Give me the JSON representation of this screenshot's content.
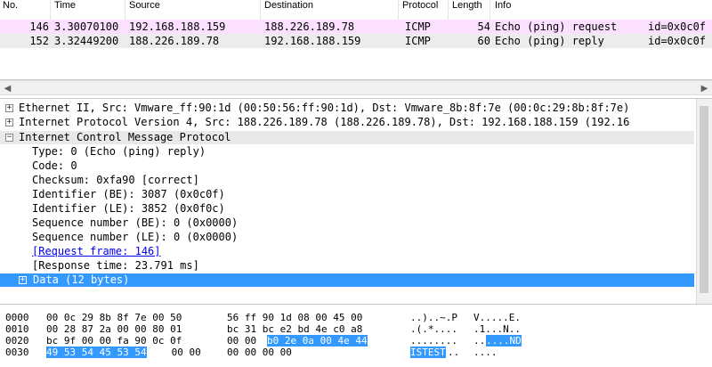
{
  "packet_list": {
    "columns": [
      "No.",
      "Time",
      "Source",
      "Destination",
      "Protocol",
      "Length",
      "Info"
    ],
    "rows": [
      {
        "no": "146",
        "time": "3.30070100",
        "source": "192.168.188.159",
        "destination": "188.226.189.78",
        "protocol": "ICMP",
        "length": "54",
        "info": "Echo (ping) request",
        "info_id": "id=0x0c0f"
      },
      {
        "no": "152",
        "time": "3.32449200",
        "source": "188.226.189.78",
        "destination": "192.168.188.159",
        "protocol": "ICMP",
        "length": "60",
        "info": "Echo (ping) reply",
        "info_id": "id=0x0c0f"
      }
    ],
    "colors": {
      "request_row": "#fce0ff",
      "reply_row": "#ececec"
    }
  },
  "scrollbar": {
    "left_arrow": "◀",
    "right_arrow": "▶"
  },
  "details": {
    "ethernet": "Ethernet II, Src: Vmware_ff:90:1d (00:50:56:ff:90:1d), Dst: Vmware_8b:8f:7e (00:0c:29:8b:8f:7e)",
    "ip": "Internet Protocol Version 4, Src: 188.226.189.78 (188.226.189.78), Dst: 192.168.188.159 (192.16",
    "icmp": "Internet Control Message Protocol",
    "fields": {
      "type": "Type: 0 (Echo (ping) reply)",
      "code": "Code: 0",
      "checksum": "Checksum: 0xfa90 [correct]",
      "identifier_be": "Identifier (BE): 3087 (0x0c0f)",
      "identifier_le": "Identifier (LE): 3852 (0x0f0c)",
      "sequence_be": "Sequence number (BE): 0 (0x0000)",
      "sequence_le": "Sequence number (LE): 0 (0x0000)",
      "request_frame": "[Request frame: 146]",
      "response_time": "[Response time: 23.791 ms]"
    },
    "data": "Data (12 bytes)",
    "expander_collapsed": "+",
    "expander_expanded": "−",
    "colors": {
      "selected": "#3399ff",
      "link": "#0000ee"
    }
  },
  "bytes": {
    "rows": [
      {
        "offset": "0000",
        "hex_a": "00 0c 29 8b 8f 7e 00 50",
        "hex_b": "56 ff 90 1d 08 00 45 00",
        "ascii_a": "..)..~.P",
        "ascii_b": "V.....E."
      },
      {
        "offset": "0010",
        "hex_a": "00 28 87 2a 00 00 80 01",
        "hex_b": "bc 31 bc e2 bd 4e c0 a8",
        "ascii_a": ".(.*....",
        "ascii_b": ".1...N.."
      },
      {
        "offset": "0020",
        "hex_a": "bc 9f 00 00 fa 90 0c 0f",
        "hex_b_plain": "00 00 ",
        "hex_b_hl": "b0 2e 0a 00 4e 44",
        "ascii_a": "........",
        "ascii_b_plain": "..",
        "ascii_b_hl": "....ND"
      },
      {
        "offset": "0030",
        "hex_a_hl": "49 53 54 45 53 54",
        "hex_a_plain": " 00 00",
        "hex_b": "00 00 00 00",
        "ascii_a_hl": "ISTEST",
        "ascii_a_plain": "..",
        "ascii_b": "...."
      }
    ]
  }
}
